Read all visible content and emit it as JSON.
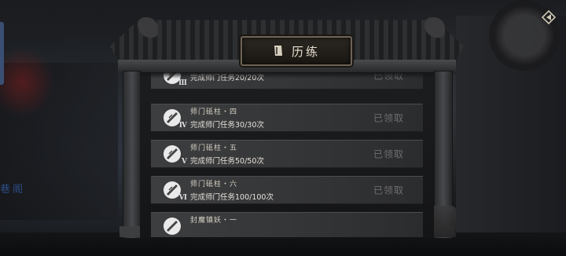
{
  "panel": {
    "title": "历练"
  },
  "background": {
    "sign_text": "巷阁"
  },
  "quests": [
    {
      "numeral": "Ⅲ",
      "name": "",
      "desc": "完成师门任务20/20次",
      "status": "已领取"
    },
    {
      "numeral": "Ⅳ",
      "name": "师门砥柱・四",
      "desc": "完成师门任务30/30次",
      "status": "已领取"
    },
    {
      "numeral": "Ⅴ",
      "name": "师门砥柱・五",
      "desc": "完成师门任务50/50次",
      "status": "已领取"
    },
    {
      "numeral": "Ⅵ",
      "name": "师门砥柱・六",
      "desc": "完成师门任务100/100次",
      "status": "已领取"
    },
    {
      "numeral": "",
      "name": "封魔镇妖・一",
      "desc": "",
      "status": ""
    }
  ],
  "colors": {
    "plaque_border": "#6d6355",
    "claimed_text": "#6e6e6e"
  }
}
